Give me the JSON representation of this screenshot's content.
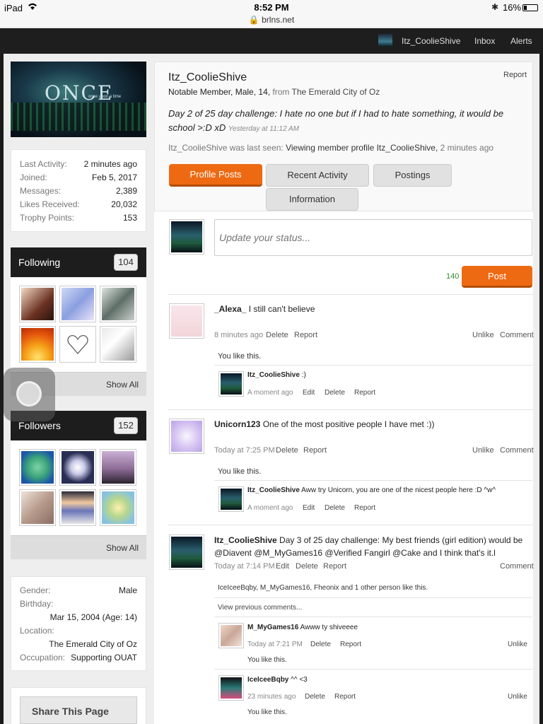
{
  "statusbar": {
    "device": "iPad",
    "time": "8:52 PM",
    "url": "brlns.net",
    "battery": "16%"
  },
  "nav": {
    "username": "Itz_CoolieShive",
    "inbox": "Inbox",
    "alerts": "Alerts"
  },
  "banner": {
    "text": "ONCE",
    "sub": "once upon a time"
  },
  "stats": [
    {
      "k": "Last Activity:",
      "v": "2 minutes ago"
    },
    {
      "k": "Joined:",
      "v": "Feb 5, 2017"
    },
    {
      "k": "Messages:",
      "v": "2,389"
    },
    {
      "k": "Likes Received:",
      "v": "20,032"
    },
    {
      "k": "Trophy Points:",
      "v": "153"
    }
  ],
  "following": {
    "label": "Following",
    "count": "104",
    "show_all": "Show All"
  },
  "followers": {
    "label": "Followers",
    "count": "152",
    "show_all": "Show All"
  },
  "about": {
    "gender_k": "Gender:",
    "gender_v": "Male",
    "birthday_k": "Birthday:",
    "birthday_v": "Mar 15, 2004 (Age: 14)",
    "location_k": "Location:",
    "location_v": "The Emerald City of Oz",
    "occupation_k": "Occupation:",
    "occupation_v": "Supporting OUAT"
  },
  "share": "Share This Page",
  "profile": {
    "name": "Itz_CoolieShive",
    "report": "Report",
    "meta": "Notable Member, Male, 14,",
    "from": "from",
    "location": "The Emerald City of Oz",
    "status": "Day 2 of 25 day challenge: I hate no one but if I had to hate something, it would be school >:D xD",
    "status_time": "Yesterday at 11:12 AM",
    "last_seen_prefix": "Itz_CoolieShive was last seen:",
    "last_seen_action": "Viewing member profile Itz_CoolieShive,",
    "last_seen_time": "2 minutes ago"
  },
  "tabs": {
    "profile_posts": "Profile Posts",
    "recent_activity": "Recent Activity",
    "postings": "Postings",
    "information": "Information"
  },
  "composer": {
    "placeholder": "Update your status...",
    "counter": "140",
    "post": "Post"
  },
  "posts": [
    {
      "author": "_Alexa_",
      "text": "I still can't believe",
      "time": "8 minutes ago",
      "delete": "Delete",
      "report": "Report",
      "unlike": "Unlike",
      "comment": "Comment",
      "likes": "You like this.",
      "reply": {
        "author": "Itz_CoolieShive",
        "text": ":)",
        "time": "A moment ago",
        "edit": "Edit",
        "delete": "Delete",
        "report": "Report"
      }
    },
    {
      "author": "Unicorn123",
      "text": "One of the most positive people I have met :))",
      "time": "Today at 7:25 PM",
      "delete": "Delete",
      "report": "Report",
      "unlike": "Unlike",
      "comment": "Comment",
      "likes": "You like this.",
      "reply": {
        "author": "Itz_CoolieShive",
        "text": "Aww try Unicorn, you are one of the nicest people here :D ^w^",
        "time": "A moment ago",
        "edit": "Edit",
        "delete": "Delete",
        "report": "Report"
      }
    },
    {
      "author": "Itz_CoolieShive",
      "text": "Day 3 of 25 day challenge: My best friends (girl edition) would be @Diavent @M_MyGames16 @Verified Fangirl @Cake and I think that's it.l",
      "time": "Today at 7:14 PM",
      "edit": "Edit",
      "delete": "Delete",
      "report": "Report",
      "comment": "Comment",
      "likes": "IceIceeBqby, M_MyGames16, Fheonix and 1 other person like this.",
      "view_previous": "View previous comments...",
      "replies": [
        {
          "author": "M_MyGames16",
          "text": "Awww ty shiveeee",
          "time": "Today at 7:21 PM",
          "delete": "Delete",
          "report": "Report",
          "unlike": "Unlike",
          "likes": "You like this."
        },
        {
          "author": "IceIceeBqby",
          "text": "^^ <3",
          "time": "23 minutes ago",
          "delete": "Delete",
          "report": "Report",
          "unlike": "Unlike",
          "likes": "You like this."
        }
      ]
    }
  ]
}
